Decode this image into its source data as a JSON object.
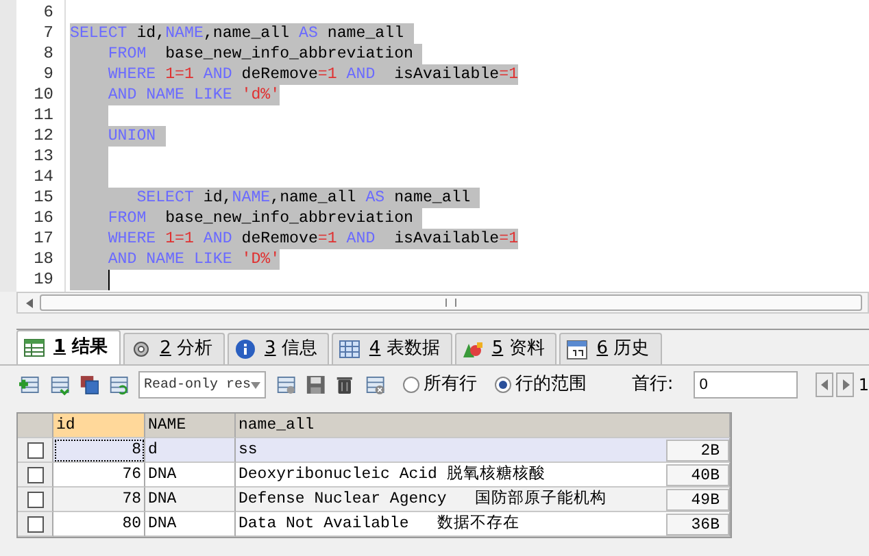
{
  "editor": {
    "lines": [
      {
        "number": "6",
        "selected": false,
        "kind": "top"
      },
      {
        "number": "7",
        "selected": true,
        "kind": "top",
        "tokens": [
          {
            "kind": "kw",
            "text": "SELECT"
          },
          {
            "kind": "plain",
            "text": " id,"
          },
          {
            "kind": "kw",
            "text": "NAME"
          },
          {
            "kind": "plain",
            "text": ",name_all "
          },
          {
            "kind": "kw",
            "text": "AS"
          },
          {
            "kind": "plain",
            "text": " name_all "
          }
        ]
      },
      {
        "number": "8",
        "selected": true,
        "kind": "body",
        "tokens": [
          {
            "kind": "kw",
            "text": "FROM"
          },
          {
            "kind": "plain",
            "text": "  base_new_info_abbreviation "
          }
        ]
      },
      {
        "number": "9",
        "selected": true,
        "kind": "body",
        "tokens": [
          {
            "kind": "kw",
            "text": "WHERE "
          },
          {
            "kind": "lit",
            "text": "1=1"
          },
          {
            "kind": "kw",
            "text": " AND"
          },
          {
            "kind": "plain",
            "text": " deRemove"
          },
          {
            "kind": "lit",
            "text": "=1"
          },
          {
            "kind": "kw",
            "text": " AND"
          },
          {
            "kind": "plain",
            "text": "  isAvailable"
          },
          {
            "kind": "lit",
            "text": "=1"
          }
        ]
      },
      {
        "number": "10",
        "selected": true,
        "kind": "body",
        "tokens": [
          {
            "kind": "kw",
            "text": "AND NAME LIKE "
          },
          {
            "kind": "lit",
            "text": "'d%'"
          }
        ]
      },
      {
        "number": "11",
        "selected": true,
        "kind": "body"
      },
      {
        "number": "12",
        "selected": true,
        "kind": "body",
        "tokens": [
          {
            "kind": "kw",
            "text": "UNION "
          }
        ]
      },
      {
        "number": "13",
        "selected": true,
        "kind": "body"
      },
      {
        "number": "14",
        "selected": true,
        "kind": "body"
      },
      {
        "number": "15",
        "selected": true,
        "kind": "nested",
        "tokens": [
          {
            "kind": "kw",
            "text": "SELECT"
          },
          {
            "kind": "plain",
            "text": " id,"
          },
          {
            "kind": "kw",
            "text": "NAME"
          },
          {
            "kind": "plain",
            "text": ",name_all "
          },
          {
            "kind": "kw",
            "text": "AS"
          },
          {
            "kind": "plain",
            "text": " name_all "
          }
        ]
      },
      {
        "number": "16",
        "selected": true,
        "kind": "body",
        "tokens": [
          {
            "kind": "kw",
            "text": "FROM"
          },
          {
            "kind": "plain",
            "text": "  base_new_info_abbreviation "
          }
        ]
      },
      {
        "number": "17",
        "selected": true,
        "kind": "body",
        "tokens": [
          {
            "kind": "kw",
            "text": "WHERE "
          },
          {
            "kind": "lit",
            "text": "1=1"
          },
          {
            "kind": "kw",
            "text": " AND"
          },
          {
            "kind": "plain",
            "text": " deRemove"
          },
          {
            "kind": "lit",
            "text": "=1"
          },
          {
            "kind": "kw",
            "text": " AND"
          },
          {
            "kind": "plain",
            "text": "  isAvailable"
          },
          {
            "kind": "lit",
            "text": "=1"
          }
        ]
      },
      {
        "number": "18",
        "selected": true,
        "kind": "body",
        "tokens": [
          {
            "kind": "kw",
            "text": "AND NAME LIKE "
          },
          {
            "kind": "lit",
            "text": "'D%'"
          }
        ]
      },
      {
        "number": "19",
        "selected": true,
        "kind": "body"
      }
    ]
  },
  "tabs": [
    {
      "key": "1",
      "label": "结果",
      "selected": true
    },
    {
      "key": "2",
      "label": "分析",
      "selected": false
    },
    {
      "key": "3",
      "label": "信息",
      "selected": false
    },
    {
      "key": "4",
      "label": "表数据",
      "selected": false
    },
    {
      "key": "5",
      "label": "资料",
      "selected": false
    },
    {
      "key": "6",
      "label": "历史",
      "selected": false
    }
  ],
  "toolbar": {
    "mode_select": "Read-only res",
    "row_options": [
      {
        "label": "所有行",
        "selected": false
      },
      {
        "label": "行的范围",
        "selected": true
      }
    ],
    "first_row_label": "首行:",
    "first_row_value": "0",
    "next_value": "1"
  },
  "grid": {
    "columns": [
      "id",
      "NAME",
      "name_all"
    ],
    "rows": [
      {
        "checked": false,
        "selected": true,
        "id": "8",
        "name": "d",
        "name_all": "ss",
        "size": "2B"
      },
      {
        "checked": false,
        "selected": false,
        "id": "76",
        "name": "DNA",
        "name_all": "Deoxyribonucleic Acid 脱氧核糖核酸",
        "size": "40B"
      },
      {
        "checked": false,
        "selected": false,
        "id": "78",
        "name": "DNA",
        "name_all": "Defense Nuclear Agency   国防部原子能机构",
        "size": "49B"
      },
      {
        "checked": false,
        "selected": false,
        "id": "80",
        "name": "DNA",
        "name_all": "Data Not Available   数据不存在",
        "size": "36B"
      }
    ]
  }
}
